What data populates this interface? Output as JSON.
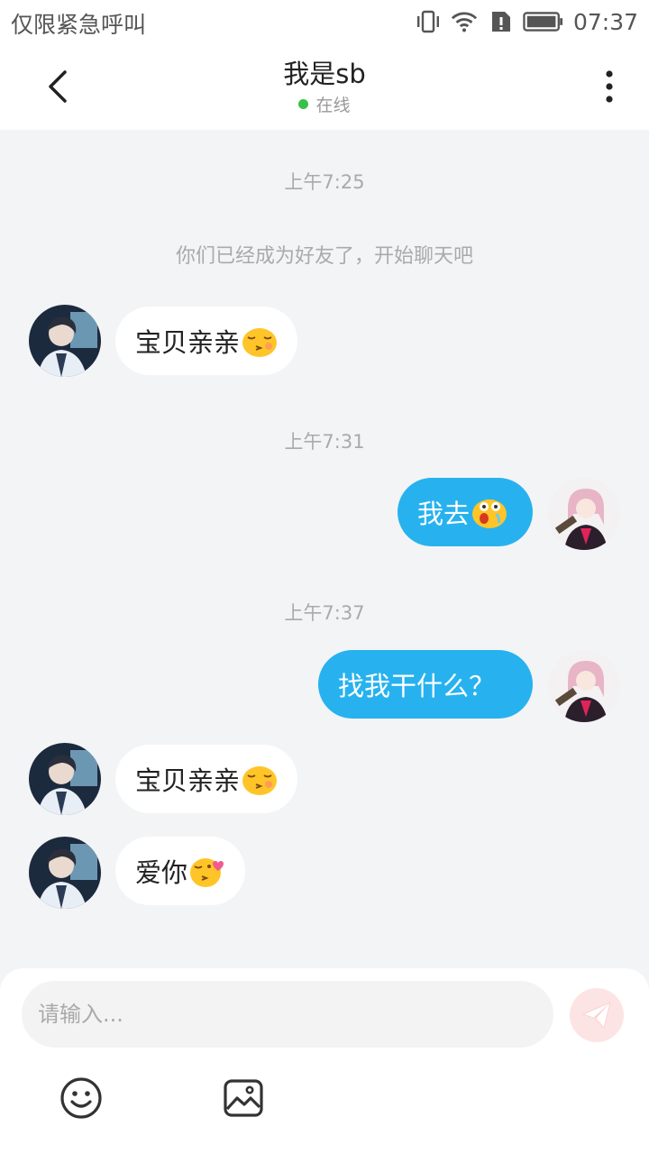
{
  "status_bar": {
    "carrier": "仅限紧急呼叫",
    "time": "07:37"
  },
  "header": {
    "title": "我是sb",
    "presence": "在线"
  },
  "chat": {
    "timestamps": [
      "上午7:25",
      "上午7:31",
      "上午7:37"
    ],
    "system_message": "你们已经成为好友了，开始聊天吧",
    "messages": [
      {
        "side": "in",
        "text": "宝贝亲亲",
        "emoji": "kiss-emoji"
      },
      {
        "side": "out",
        "text": "我去",
        "emoji": "shocked-emoji"
      },
      {
        "side": "out",
        "text": "找我干什么？"
      },
      {
        "side": "in",
        "text": "宝贝亲亲",
        "emoji": "kiss-emoji"
      },
      {
        "side": "in",
        "text": "爱你",
        "emoji": "kiss-heart-emoji"
      }
    ]
  },
  "composer": {
    "placeholder": "请输入..."
  },
  "colors": {
    "accent": "#27b2ef",
    "online": "#37c14a",
    "background": "#f3f4f6"
  }
}
